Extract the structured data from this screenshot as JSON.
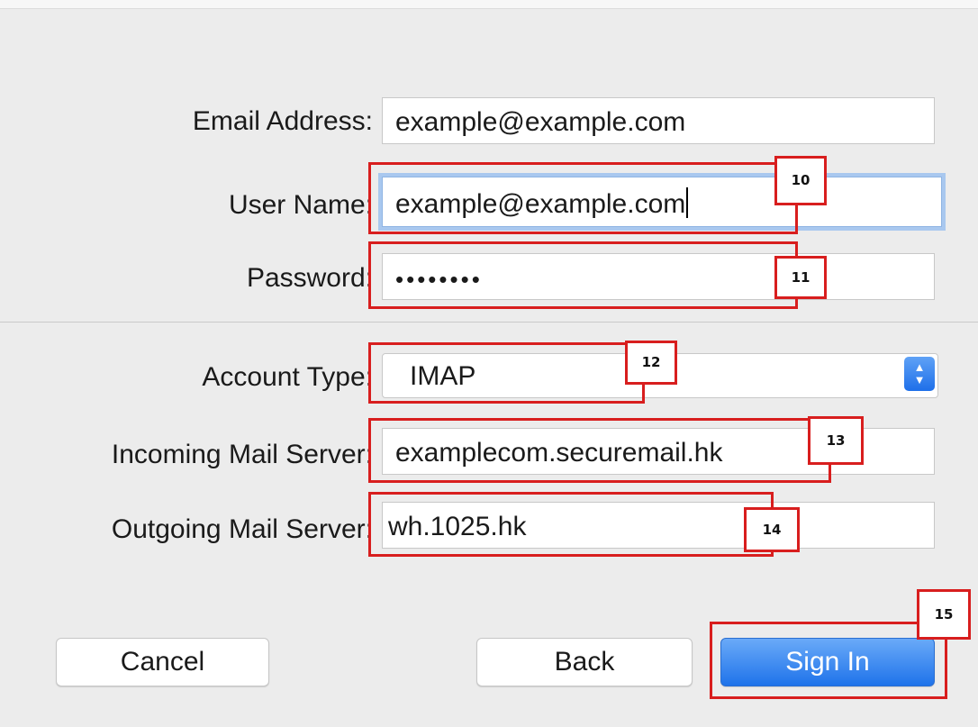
{
  "form": {
    "email_label": "Email Address:",
    "email_value": "example@example.com",
    "username_label": "User Name:",
    "username_value": "example@example.com",
    "password_label": "Password:",
    "password_value": "••••••••",
    "account_type_label": "Account Type:",
    "account_type_value": "IMAP",
    "incoming_label": "Incoming Mail Server:",
    "incoming_value": "examplecom.securemail.hk",
    "outgoing_label": "Outgoing Mail Server:",
    "outgoing_value": "wh.1025.hk"
  },
  "buttons": {
    "cancel": "Cancel",
    "back": "Back",
    "sign_in": "Sign In"
  },
  "annotations": {
    "step10": "10",
    "step11": "11",
    "step12": "12",
    "step13": "13",
    "step14": "14",
    "step15": "15"
  },
  "icons": {
    "account_type_stepper": "up-down-chevron-icon"
  },
  "colors": {
    "background": "#ececec",
    "focus_ring": "#a9c8ef",
    "primary_button": "#1f73ea",
    "annotation_red": "#d81e1e"
  }
}
